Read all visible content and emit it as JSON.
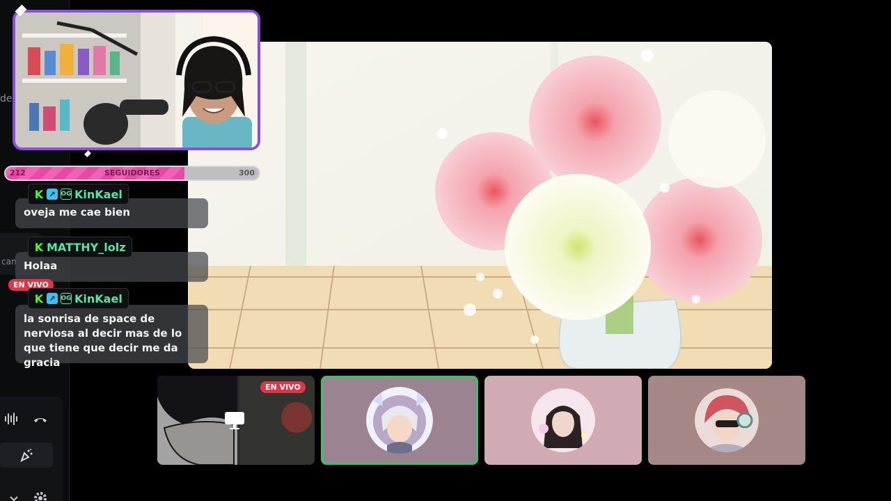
{
  "sidebar": {
    "fragment_top": "de",
    "fragment_mid": "can",
    "voice_icons": [
      "soundwave-icon",
      "hangup-icon",
      "activity-icon",
      "chevron-down-icon",
      "gear-icon"
    ]
  },
  "follower_goal": {
    "current": "212",
    "label": "SEGUIDORES",
    "target": "300",
    "progress": 0.7067,
    "colors": {
      "fill": "#f061b8",
      "track": "#bfbfbf"
    }
  },
  "chat": {
    "messages": [
      {
        "user": "KinKael",
        "badges": [
          "kick-badge",
          "verified-badge",
          "og-badge"
        ],
        "text": "oveja me cae bien"
      },
      {
        "user": "MATTHY_lolz",
        "badges": [
          "kick-badge"
        ],
        "text": "Holaa"
      },
      {
        "user": "KinKael",
        "badges": [
          "kick-badge",
          "verified-badge",
          "og-badge"
        ],
        "text": "la sonrisa de space de nerviosa al decir mas de lo que tiene que decir me da gracia"
      }
    ],
    "badge_glyphs": {
      "kick": "K",
      "verified": "↗",
      "og": "OG"
    },
    "live_label": "EN VIVO"
  },
  "participants": [
    {
      "name": "screen-share",
      "live_label": "EN VIVO",
      "bg": "#2b2c30"
    },
    {
      "name": "participant-2",
      "bg": "#9b8391",
      "speaking": true
    },
    {
      "name": "participant-3",
      "bg": "#d1abb3"
    },
    {
      "name": "participant-4",
      "bg": "#a58786"
    }
  ],
  "colors": {
    "accent_purple": "#8a4fd8",
    "chat_name": "#53e6a4",
    "live_red": "#e03546",
    "speaking_green": "#3fbf6a"
  }
}
